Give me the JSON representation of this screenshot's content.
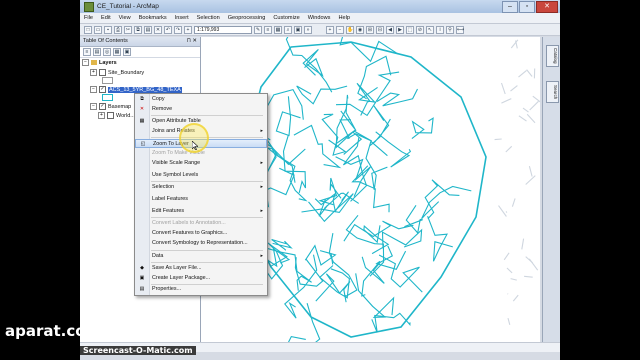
{
  "window": {
    "title": "CE_Tutorial - ArcMap"
  },
  "menubar": [
    "File",
    "Edit",
    "View",
    "Bookmarks",
    "Insert",
    "Selection",
    "Geoprocessing",
    "Customize",
    "Windows",
    "Help"
  ],
  "toolbar": {
    "scale": "1:179,993"
  },
  "toc": {
    "title": "Table Of Contents",
    "root": "Layers",
    "layers": [
      {
        "name": "Site_Boundary",
        "checked": false
      },
      {
        "name": "ACS_13_5YR_BG_48_TEXA",
        "checked": true,
        "selected": true
      },
      {
        "name": "Basemap",
        "checked": true
      },
      {
        "name": "World...",
        "checked": false
      }
    ]
  },
  "context_menu": {
    "items": [
      {
        "label": "Copy",
        "icon": "copy-icon"
      },
      {
        "label": "Remove",
        "icon": "remove-icon"
      },
      {
        "label": "Open Attribute Table",
        "icon": "table-icon"
      },
      {
        "label": "Joins and Relates",
        "submenu": true
      },
      {
        "label": "Zoom To Layer",
        "icon": "zoom-layer-icon",
        "hover": true
      },
      {
        "label": "Zoom To Make Visible",
        "disabled": true
      },
      {
        "label": "Visible Scale Range",
        "submenu": true
      },
      {
        "label": "Use Symbol Levels"
      },
      {
        "label": "Selection",
        "submenu": true
      },
      {
        "label": "Label Features"
      },
      {
        "label": "Edit Features",
        "submenu": true
      },
      {
        "label": "Convert Labels to Annotation...",
        "disabled": true
      },
      {
        "label": "Convert Features to Graphics..."
      },
      {
        "label": "Convert Symbology to Representation..."
      },
      {
        "label": "Data",
        "submenu": true
      },
      {
        "label": "Save As Layer File...",
        "icon": "save-layer-icon"
      },
      {
        "label": "Create Layer Package...",
        "icon": "package-icon"
      },
      {
        "label": "Properties...",
        "icon": "properties-icon"
      }
    ]
  },
  "rightbar": {
    "tabs": [
      "Catalog",
      "Search"
    ]
  },
  "watermarks": {
    "site": "aparat.com",
    "recorder": "Screencast-O-Matic.com"
  },
  "colors": {
    "map_lines": "#1fb6c9",
    "selected": "#3264c8"
  }
}
